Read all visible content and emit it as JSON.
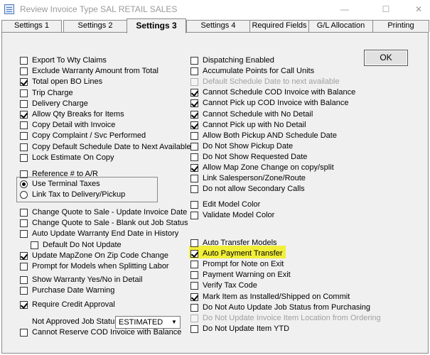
{
  "window": {
    "title": "Review Invoice Type  SAL RETAIL SALES",
    "minimize_glyph": "—",
    "maximize_glyph": "☐",
    "close_glyph": "✕"
  },
  "tabs": [
    {
      "label": "Settings 1",
      "active": false
    },
    {
      "label": "Settings 2",
      "active": false
    },
    {
      "label": "Settings 3",
      "active": true
    },
    {
      "label": "Settings 4",
      "active": false
    },
    {
      "label": "Required Fields",
      "active": false
    },
    {
      "label": "G/L Allocation",
      "active": false
    },
    {
      "label": "Printing",
      "active": false
    }
  ],
  "ok_label": "OK",
  "left_options": [
    {
      "label": "Export To Wty Claims",
      "checked": false
    },
    {
      "label": "Exclude Warranty Amount from Total",
      "checked": false
    },
    {
      "label": "Total open BO Lines",
      "checked": true
    },
    {
      "label": "Trip Charge",
      "checked": false
    },
    {
      "label": "Delivery Charge",
      "checked": false
    },
    {
      "label": "Allow Qty Breaks for Items",
      "checked": true
    },
    {
      "label": "Copy Detail with Invoice",
      "checked": false
    },
    {
      "label": "Copy Complaint / Svc Performed",
      "checked": false
    },
    {
      "label": "Copy Default Schedule Date to Next Available",
      "checked": false
    },
    {
      "label": "Lock Estimate On Copy",
      "checked": false
    },
    {
      "label": "Reference # to A/R",
      "checked": false
    }
  ],
  "tax_options": [
    {
      "label": "Use Terminal Taxes",
      "selected": true
    },
    {
      "label": "Link Tax to Delivery/Pickup",
      "selected": false
    }
  ],
  "left_options_2": [
    {
      "label": "Change Quote to Sale - Update Invoice Date",
      "checked": false
    },
    {
      "label": "Change Quote to Sale - Blank out Job Status",
      "checked": false
    },
    {
      "label": "Auto Update Warranty End Date in History",
      "checked": false
    },
    {
      "label": "Default Do Not Update",
      "checked": false
    },
    {
      "label": "Update MapZone On Zip Code Change",
      "checked": true
    },
    {
      "label": "Prompt for Models when Splitting Labor",
      "checked": false
    },
    {
      "label": "Show Warranty Yes/No in Detail",
      "checked": false
    },
    {
      "label": "Purchase Date Warning",
      "checked": false
    },
    {
      "label": "Require Credit Approval",
      "checked": true
    }
  ],
  "not_approved_label": "Not Approved Job Status",
  "not_approved_value": "ESTIMATED",
  "cannot_reserve": {
    "label": "Cannot Reserve COD Invoice with Balance",
    "checked": false
  },
  "right_options": [
    {
      "label": "Dispatching Enabled",
      "checked": false,
      "disabled": false
    },
    {
      "label": "Accumulate Points for Call Units",
      "checked": false,
      "disabled": false
    },
    {
      "label": "Default Schedule Date to next available",
      "checked": false,
      "disabled": true
    },
    {
      "label": "Cannot Schedule COD Invoice with Balance",
      "checked": true,
      "disabled": false
    },
    {
      "label": "Cannot Pick up COD Invoice with Balance",
      "checked": true,
      "disabled": false
    },
    {
      "label": "Cannot Schedule with No Detail",
      "checked": true,
      "disabled": false
    },
    {
      "label": "Cannot Pick up with No Detail",
      "checked": true,
      "disabled": false
    },
    {
      "label": "Allow Both Pickup AND Schedule Date",
      "checked": false,
      "disabled": false
    },
    {
      "label": "Do Not Show Pickup Date",
      "checked": false,
      "disabled": false
    },
    {
      "label": "Do Not Show Requested Date",
      "checked": false,
      "disabled": false
    },
    {
      "label": "Allow Map Zone Change on copy/split",
      "checked": true,
      "disabled": false
    },
    {
      "label": "Link Salesperson/Zone/Route",
      "checked": false,
      "disabled": false
    },
    {
      "label": "Do not allow Secondary Calls",
      "checked": false,
      "disabled": false
    }
  ],
  "right_options_2": [
    {
      "label": "Edit Model Color",
      "checked": false,
      "disabled": false
    },
    {
      "label": "Validate Model Color",
      "checked": false,
      "disabled": false
    }
  ],
  "right_options_3": [
    {
      "label": "Auto Transfer Models",
      "checked": false,
      "disabled": false
    },
    {
      "label": "Auto Payment Transfer",
      "checked": true,
      "disabled": false
    },
    {
      "label": "Prompt for Note on Exit",
      "checked": false,
      "disabled": false
    },
    {
      "label": "Payment Warning on Exit",
      "checked": false,
      "disabled": false
    },
    {
      "label": "Verify Tax Code",
      "checked": false,
      "disabled": false
    },
    {
      "label": "Mark Item as Installed/Shipped on Commit",
      "checked": true,
      "disabled": false
    },
    {
      "label": "Do Not Auto Update Job Status from Purchasing",
      "checked": false,
      "disabled": false
    },
    {
      "label": "Do Not  Update Invoice Item Location from Ordering",
      "checked": false,
      "disabled": true
    },
    {
      "label": "Do Not Update Item YTD",
      "checked": false,
      "disabled": false
    }
  ],
  "highlight_color": "#f2ef3a"
}
